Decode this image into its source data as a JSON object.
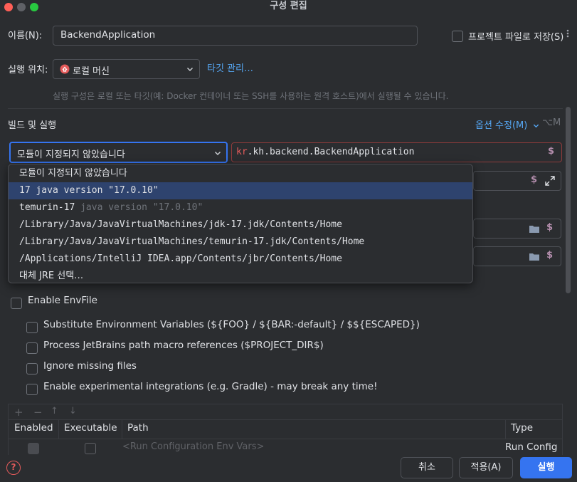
{
  "window": {
    "title": "구성 편집"
  },
  "name_row": {
    "label": "이름(N):",
    "value": "BackendApplication",
    "store_label": "프로젝트 파일로 저장(S)"
  },
  "run_on": {
    "label": "실행 위치:",
    "value": "로컬 머신",
    "manage_link": "타깃 관리…",
    "hint": "실행 구성은 로컬 또는 타깃(예: Docker 컨테이너 또는 SSH를 사용하는 원격 호스트)에서 실행될 수 있습니다."
  },
  "build_run": {
    "label": "빌드 및 실행",
    "modify_options": "옵션 수정(M)",
    "shortcut": "⌥M"
  },
  "jre_select": {
    "value": "모듈이 지정되지 않았습니다"
  },
  "main_class": {
    "prefix": "kr",
    "rest": ".kh.backend.BackendApplication",
    "dollar": "$"
  },
  "dropdown": {
    "items": [
      {
        "main": "모듈이 지정되지 않았습니다",
        "dim": ""
      },
      {
        "main": "17 java version \"17.0.10\"",
        "dim": ""
      },
      {
        "main": "temurin-17 ",
        "dim": "java version \"17.0.10\""
      },
      {
        "main": "/Library/Java/JavaVirtualMachines/jdk-17.jdk/Contents/Home",
        "dim": ""
      },
      {
        "main": "/Library/Java/JavaVirtualMachines/temurin-17.jdk/Contents/Home",
        "dim": ""
      },
      {
        "main": "/Applications/IntelliJ IDEA.app/Contents/jbr/Contents/Home",
        "dim": ""
      },
      {
        "main": "대체 JRE 선택…",
        "dim": ""
      }
    ],
    "selected_index": 1
  },
  "envfile": {
    "enable_label": "Enable EnvFile",
    "options": [
      "Substitute Environment Variables (${FOO} / ${BAR:-default} / $${ESCAPED})",
      "Process JetBrains path macro references ($PROJECT_DIR$)",
      "Ignore missing files",
      "Enable experimental integrations (e.g. Gradle) - may break any time!"
    ],
    "table": {
      "headers": [
        "Enabled",
        "Executable",
        "Path",
        "Type"
      ],
      "row": {
        "path": "<Run Configuration Env Vars>",
        "type": "Run Config"
      }
    }
  },
  "toolbar": {
    "add": "+",
    "remove": "−",
    "up": "↑",
    "down": "↓"
  },
  "footer": {
    "help": "?",
    "cancel": "취소",
    "apply": "적용(A)",
    "run": "실행"
  },
  "colors": {
    "accent": "#3574f0",
    "selection": "#2e436e",
    "error_border": "#8e3b3b",
    "link": "#56a8f5"
  }
}
